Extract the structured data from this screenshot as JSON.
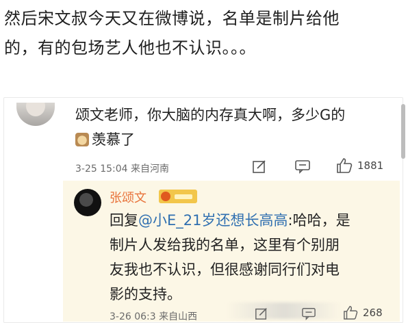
{
  "intro": {
    "line1": "然后宋文叔今天又在微博说，名单是制片给他",
    "line2": "的，有的包场艺人他也不认识。。。"
  },
  "comment": {
    "text_line1": "颂文老师，你大脑的内存真大啊，多少G的",
    "text_line2": "羡慕了",
    "emoji_icon": "envy-emoji-icon",
    "timestamp": "3-25 15:04",
    "source": "来自河南",
    "likes": "1881"
  },
  "reply": {
    "author": "张颂文",
    "reply_prefix": "回复",
    "mention": "@小E_21岁还想长高高",
    "text_after_mention": ":哈哈，是",
    "line2": "制片人发给我的名单，这里有个别朋",
    "line3": "友我也不认识，但很感谢同行们对电",
    "line4": "影的支持。",
    "timestamp": "3-26 06:3",
    "source": "来自山西",
    "likes": "268"
  },
  "colors": {
    "author_name": "#e8723a",
    "mention": "#2f6fb0",
    "reply_bg": "#fcf7e6",
    "badge": "#f2c64b"
  }
}
